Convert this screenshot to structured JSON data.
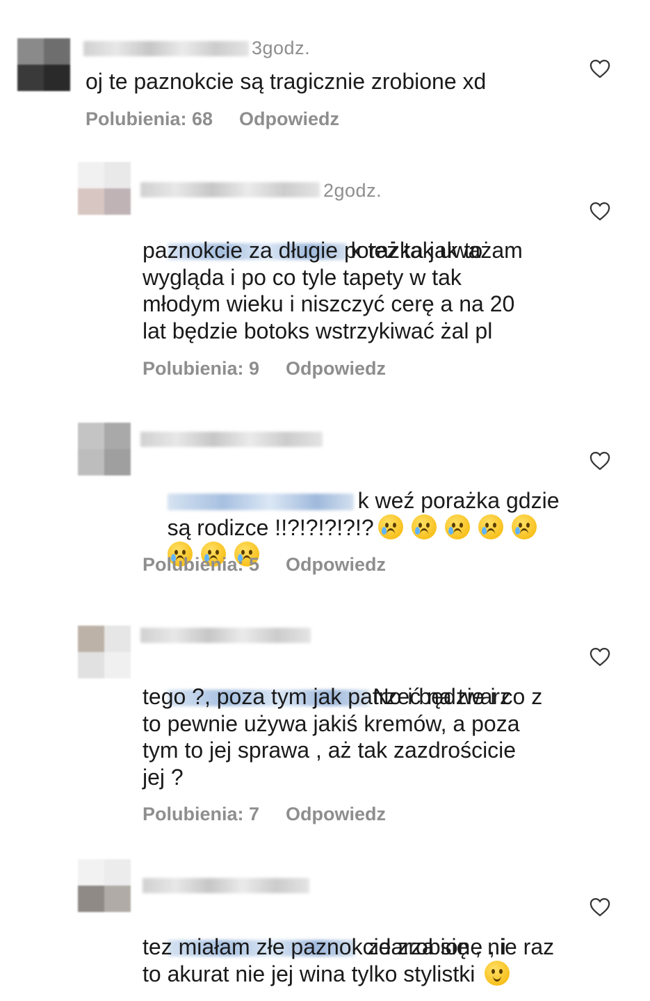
{
  "heart_icon": "heart-outline-icon",
  "colors": {
    "text": "#1a1a1a",
    "meta": "#8e8e8e"
  },
  "comments": [
    {
      "username": "",
      "time": "3godz.",
      "text": "oj te paznokcie są tragicznie zrobione xd",
      "likes": "Polubienia: 68",
      "reply": "Odpowiedz"
    },
    {
      "username": "",
      "time": "2godz.",
      "line1": "k też tak uważam",
      "text": "paznokcie za długie porażka jak to\nwygląda i po co tyle tapety w tak\nmłodym wieku i niszczyć cerę a na 20\nlat będzie botoks wstrzykiwać żal pl",
      "likes": "Polubienia: 9",
      "reply": "Odpowiedz"
    },
    {
      "username": "",
      "time": "",
      "line1": "k weź porażka gdzie",
      "line2": "są rodizce !!?!?!?!?!?",
      "emoji": "crying-face",
      "likes": "Polubienia: 5",
      "reply": "Odpowiedz"
    },
    {
      "username": "",
      "time": "",
      "line1": "No i będzie i co z",
      "text": "tego ?, poza tym jak patrzeć na twarz\nto pewnie używa jakiś kremów, a poza\ntym to jej sprawa , aż tak zazdrościcie\njej ?",
      "likes": "Polubienia: 7",
      "reply": "Odpowiedz"
    },
    {
      "username": "",
      "time": "",
      "line1": "zdarza się , nie raz",
      "text": "tez miałam złe paznokcie zrobione , i\nto akurat nie jej wina tylko stylistki",
      "emoji": "winking-face"
    }
  ]
}
